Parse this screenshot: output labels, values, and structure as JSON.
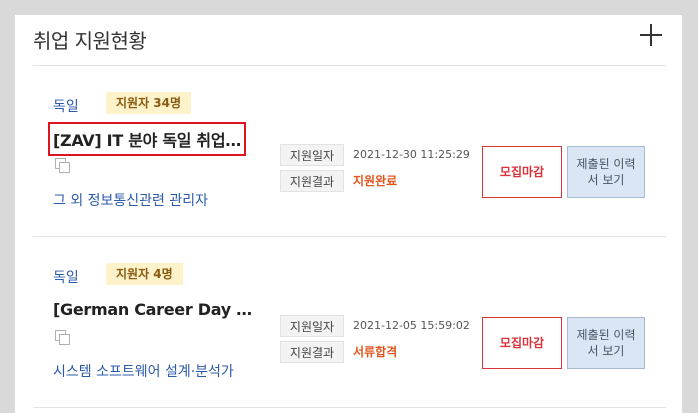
{
  "section": {
    "title": "취업 지원현황",
    "add_icon": "plus-icon"
  },
  "applications": [
    {
      "country": "독일",
      "applicants_badge": "지원자 34명",
      "job_title": "[ZAV] IT 분야 독일 취업…",
      "job_field": "그 외 정보통신관련 관리자",
      "date_label": "지원일자",
      "date_value": "2021-12-30 11:25:29",
      "result_label": "지원결과",
      "result_value": "지원완료",
      "closed_button": "모집마감",
      "resume_button": "제출된 이력서 보기"
    },
    {
      "country": "독일",
      "applicants_badge": "지원자 4명",
      "job_title": "[German Career Day …",
      "job_field": "시스템 소프트웨어 설계·분석가",
      "date_label": "지원일자",
      "date_value": "2021-12-05 15:59:02",
      "result_label": "지원결과",
      "result_value": "서류합격",
      "closed_button": "모집마감",
      "resume_button": "제출된 이력서 보기"
    }
  ],
  "colors": {
    "highlight": "#e0141e",
    "link": "#2b5aa8",
    "result": "#e0561e",
    "badge_bg": "#fdf2c9"
  }
}
